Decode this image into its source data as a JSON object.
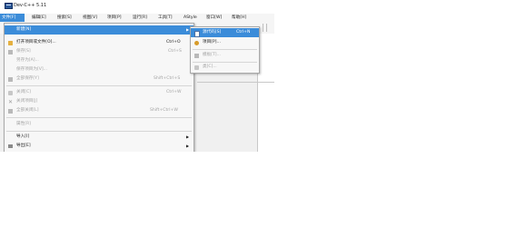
{
  "window": {
    "title": "Dev-C++ 5.11"
  },
  "menubar": {
    "items": [
      {
        "label": "文件[F]",
        "active": true
      },
      {
        "label": "编辑[E]"
      },
      {
        "label": "搜索[S]"
      },
      {
        "label": "视图[V]"
      },
      {
        "label": "项目[P]"
      },
      {
        "label": "运行[R]"
      },
      {
        "label": "工具[T]"
      },
      {
        "label": "AStyle"
      },
      {
        "label": "窗口[W]"
      },
      {
        "label": "帮助[H]"
      }
    ]
  },
  "file_menu": {
    "items": [
      {
        "label": "新建[N]",
        "shortcut": "",
        "submenu": true,
        "highlighted": true,
        "icon": ""
      },
      {
        "label": "打开项目或文件[O]...",
        "shortcut": "Ctrl+O",
        "icon": "open-folder-icon"
      },
      {
        "label": "保存[S]",
        "shortcut": "Ctrl+S",
        "disabled": true,
        "icon": "save-icon"
      },
      {
        "label": "另存为[A]...",
        "shortcut": "",
        "disabled": true
      },
      {
        "label": "保存项目为[V]...",
        "shortcut": "",
        "disabled": true
      },
      {
        "label": "全部保存[Y]",
        "shortcut": "Shift+Ctrl+S",
        "disabled": true,
        "icon": "save-all-icon"
      },
      {
        "label": "关闭[C]",
        "shortcut": "Ctrl+W",
        "disabled": true,
        "icon": "close-file-icon"
      },
      {
        "label": "关闭项目[J]",
        "shortcut": "",
        "disabled": true,
        "icon": "close-project-icon"
      },
      {
        "label": "全部关闭[L]",
        "shortcut": "Shift+Ctrl+W",
        "disabled": true,
        "icon": "close-all-icon"
      },
      {
        "label": "属性[R]",
        "shortcut": "",
        "disabled": true
      },
      {
        "label": "导入[I]",
        "shortcut": "",
        "submenu": true
      },
      {
        "label": "导出[E]",
        "shortcut": "",
        "submenu": true,
        "icon": "export-icon"
      }
    ]
  },
  "new_submenu": {
    "items": [
      {
        "label": "源代码[S]",
        "shortcut": "Ctrl+N",
        "highlighted": true,
        "icon": "source-file-icon"
      },
      {
        "label": "项目[P]...",
        "shortcut": "",
        "icon": "project-icon"
      },
      {
        "label": "模板[T]...",
        "shortcut": "",
        "disabled": true,
        "icon": "template-icon"
      },
      {
        "label": "类[C]...",
        "shortcut": "",
        "disabled": true,
        "icon": "class-icon"
      }
    ]
  },
  "colors": {
    "highlight": "#3b8cd9",
    "disabled_text": "#a4a4a4",
    "menu_bg": "#f7f7f7"
  }
}
